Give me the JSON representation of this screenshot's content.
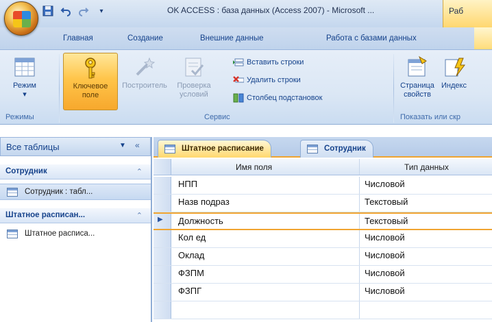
{
  "window": {
    "title": "OK ACCESS : база данных (Access 2007) - Microsoft ...",
    "context_label": "Раб"
  },
  "quick_access": [
    {
      "icon": "save-icon"
    },
    {
      "icon": "undo-icon"
    },
    {
      "icon": "redo-icon"
    },
    {
      "icon": "customize-qat-icon"
    }
  ],
  "ribbon_tabs": [
    "Главная",
    "Создание",
    "Внешние данные",
    "Работа с базами данных"
  ],
  "ribbon": {
    "groups": {
      "views": "Режимы",
      "tools": "Сервис",
      "show_hide": "Показать или скр"
    },
    "buttons": {
      "view": [
        "Режим"
      ],
      "primary_key": [
        "Ключевое",
        "поле"
      ],
      "builder": [
        "Построитель"
      ],
      "test_validation": [
        "Проверка",
        "условий"
      ],
      "insert_rows": "Вставить строки",
      "delete_rows": "Удалить строки",
      "lookup_column": "Столбец подстановок",
      "property_sheet": [
        "Страница",
        "свойств"
      ],
      "indexes": [
        "Индекс"
      ]
    }
  },
  "nav_pane": {
    "title": "Все таблицы",
    "groups": [
      {
        "label": "Сотрудник",
        "items": [
          "Сотрудник : табл..."
        ]
      },
      {
        "label": "Штатное расписан...",
        "items": [
          "Штатное расписа..."
        ]
      }
    ]
  },
  "document_tabs": [
    {
      "label": "Штатное расписание",
      "active": true
    },
    {
      "label": "Сотрудник",
      "active": false
    }
  ],
  "design_grid": {
    "headers": {
      "field_name": "Имя поля",
      "data_type": "Тип данных"
    },
    "current_row": 2,
    "rows": [
      {
        "name": "НПП",
        "type": "Числовой"
      },
      {
        "name": "Назв подраз",
        "type": "Текстовый"
      },
      {
        "name": "Должность",
        "type": "Текстовый"
      },
      {
        "name": "Кол ед",
        "type": "Числовой"
      },
      {
        "name": "Оклад",
        "type": "Числовой"
      },
      {
        "name": "ФЗПМ",
        "type": "Числовой"
      },
      {
        "name": "ФЗПГ",
        "type": "Числовой"
      },
      {
        "name": "",
        "type": ""
      }
    ]
  },
  "colors": {
    "accent": "#f0a42f",
    "ribbon_blue": "#dbe7f5",
    "text_blue": "#15428b"
  }
}
